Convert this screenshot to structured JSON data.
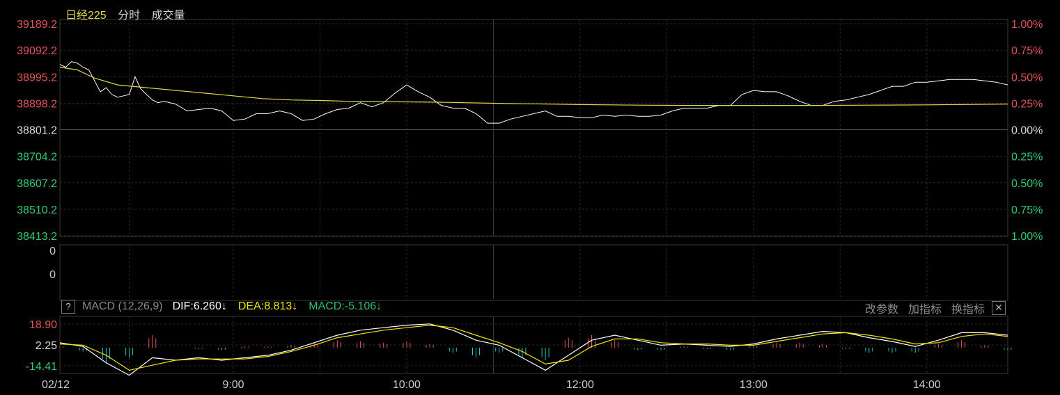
{
  "header": {
    "name": "日经225",
    "tab_minute": "分时",
    "tab_volume": "成交量"
  },
  "macd_header": {
    "help": "?",
    "name": "MACD (12,26,9)",
    "dif": "DIF:6.260↓",
    "dea": "DEA:8.813↓",
    "macd": "MACD:-5.106↓"
  },
  "tools": {
    "params": "改参数",
    "add": "加指标",
    "switch": "换指标",
    "close": "✕"
  },
  "colors": {
    "up": "#e05555",
    "down": "#2ecc71",
    "price": "#ffffff",
    "avg": "#e6d84a",
    "dif": "#ffffff",
    "dea": "#f2e600",
    "hist_up": "#e05555",
    "hist_down": "#27c2c2",
    "grid": "#2a2a2a",
    "border": "#3a3a3a"
  },
  "chart_data": [
    {
      "type": "line",
      "title": "日经225 分时",
      "y_left_ticks": [
        "39189.2",
        "39092.2",
        "38995.2",
        "38898.2",
        "38801.2",
        "38704.2",
        "38607.2",
        "38510.2",
        "38413.2"
      ],
      "y_right_ticks": [
        "1.00%",
        "0.75%",
        "0.50%",
        "0.25%",
        "0.00%",
        "0.25%",
        "0.50%",
        "0.75%",
        "1.00%"
      ],
      "ylim": [
        38413.2,
        39189.2
      ],
      "base": 38801.2,
      "x_ticks": [
        {
          "t": 0,
          "label": "02/12"
        },
        {
          "t": 30,
          "label": "9:00"
        },
        {
          "t": 60,
          "label": "10:00"
        },
        {
          "t": 90,
          "label": "12:00"
        },
        {
          "t": 120,
          "label": "13:00"
        },
        {
          "t": 150,
          "label": "14:00"
        }
      ],
      "xlim": [
        0,
        164
      ],
      "series": [
        {
          "x": [
            0,
            1,
            2,
            3,
            4,
            5,
            6,
            7,
            8,
            9,
            10,
            11,
            12,
            13,
            14,
            15,
            16,
            17,
            18,
            20,
            22,
            24,
            26,
            28,
            30,
            32,
            34,
            36,
            38,
            40,
            42,
            44,
            46,
            48,
            50,
            52,
            54,
            56,
            58,
            60,
            62,
            64,
            66,
            68,
            70,
            72,
            74,
            76,
            78,
            80,
            82,
            84,
            86,
            88,
            90,
            92,
            94,
            96,
            98,
            100,
            102,
            104,
            106,
            108,
            110,
            112,
            114,
            116,
            118,
            120,
            122,
            124,
            126,
            128,
            130,
            132,
            134,
            136,
            138,
            140,
            142,
            144,
            146,
            148,
            150,
            152,
            154,
            156,
            158,
            160,
            162,
            164
          ],
          "values": [
            39040,
            39030,
            39050,
            39045,
            39030,
            39020,
            38980,
            38940,
            38955,
            38930,
            38920,
            38925,
            38930,
            38995,
            38950,
            38930,
            38910,
            38900,
            38905,
            38895,
            38870,
            38875,
            38880,
            38870,
            38835,
            38840,
            38860,
            38860,
            38870,
            38860,
            38835,
            38840,
            38860,
            38875,
            38880,
            38900,
            38885,
            38900,
            38935,
            38965,
            38940,
            38920,
            38890,
            38880,
            38880,
            38860,
            38825,
            38825,
            38840,
            38850,
            38860,
            38870,
            38850,
            38850,
            38845,
            38845,
            38855,
            38850,
            38855,
            38850,
            38850,
            38855,
            38870,
            38880,
            38880,
            38880,
            38890,
            38890,
            38930,
            38945,
            38940,
            38940,
            38925,
            38905,
            38890,
            38890,
            38905,
            38910,
            38920,
            38930,
            38945,
            38960,
            38960,
            38975,
            38975,
            38980,
            38985,
            38985,
            38985,
            38980,
            38975,
            38965
          ]
        },
        {
          "x": [
            0,
            3,
            6,
            10,
            15,
            20,
            25,
            30,
            35,
            40,
            45,
            50,
            55,
            60,
            65,
            70,
            75,
            80,
            85,
            90,
            100,
            110,
            120,
            130,
            140,
            150,
            164
          ],
          "values": [
            39030,
            39020,
            38990,
            38965,
            38955,
            38945,
            38935,
            38925,
            38915,
            38910,
            38908,
            38905,
            38904,
            38903,
            38902,
            38900,
            38898,
            38896,
            38895,
            38893,
            38891,
            38890,
            38890,
            38890,
            38891,
            38892,
            38895
          ]
        }
      ]
    },
    {
      "type": "bar",
      "title": "成交量",
      "y_ticks": [
        "0",
        "0"
      ],
      "values": []
    },
    {
      "type": "bar",
      "title": "MACD (12,26,9)",
      "y_ticks": [
        "18.90",
        "2.25",
        "-14.41"
      ],
      "ylim": [
        -20,
        25
      ],
      "x": [
        0,
        4,
        8,
        12,
        16,
        20,
        24,
        28,
        32,
        36,
        40,
        44,
        48,
        52,
        56,
        60,
        64,
        68,
        72,
        76,
        80,
        84,
        88,
        92,
        96,
        100,
        104,
        108,
        112,
        116,
        120,
        124,
        128,
        132,
        136,
        140,
        144,
        148,
        152,
        156,
        160,
        164
      ],
      "dif": [
        4,
        1,
        -12,
        -22,
        -8,
        -10,
        -8,
        -10,
        -8,
        -6,
        -2,
        4,
        10,
        14,
        16,
        18,
        19,
        14,
        6,
        2,
        -8,
        -18,
        -6,
        6,
        10,
        6,
        2,
        3,
        2,
        1,
        3,
        7,
        10,
        13,
        12,
        8,
        5,
        1,
        6,
        12,
        12,
        10
      ],
      "dea": [
        3,
        2,
        -6,
        -18,
        -14,
        -10,
        -9,
        -9,
        -9,
        -7,
        -3,
        2,
        8,
        11,
        14,
        16,
        18,
        16,
        10,
        4,
        -3,
        -13,
        -10,
        1,
        7,
        7,
        4,
        3,
        3,
        2,
        2,
        5,
        8,
        11,
        12,
        10,
        7,
        3,
        4,
        9,
        11,
        9
      ],
      "macd": [
        1,
        -3,
        -12,
        -8,
        10,
        0,
        -1,
        -2,
        1,
        1,
        2,
        4,
        6,
        5,
        4,
        5,
        3,
        -4,
        -8,
        -4,
        -8,
        -10,
        8,
        10,
        6,
        -2,
        -2,
        1,
        -1,
        -2,
        2,
        4,
        4,
        3,
        -1,
        -4,
        -4,
        -4,
        3,
        6,
        2,
        -2
      ]
    }
  ]
}
